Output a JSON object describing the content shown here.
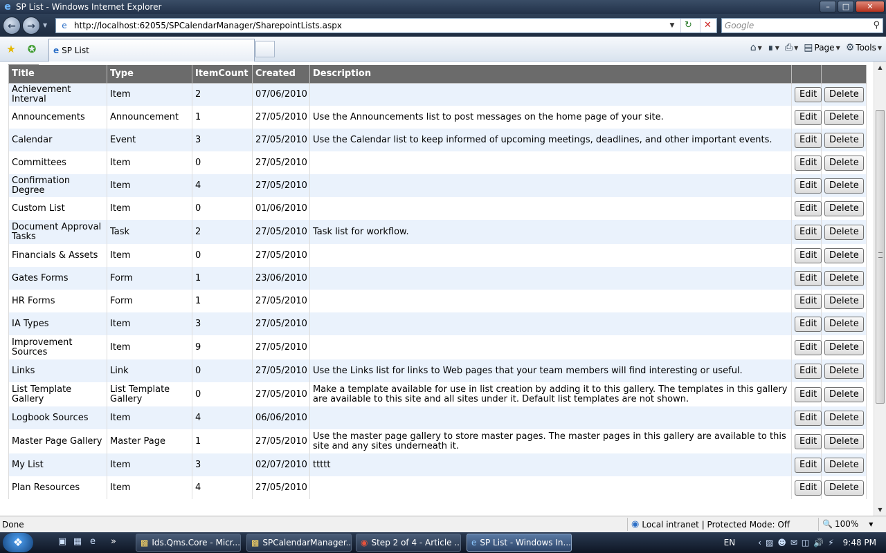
{
  "window": {
    "title": "SP List - Windows Internet Explorer"
  },
  "browser": {
    "url": "http://localhost:62055/SPCalendarManager/SharepointLists.aspx",
    "search_placeholder": "Google",
    "tab_title": "SP List",
    "commands": {
      "page": "Page",
      "tools": "Tools"
    }
  },
  "table": {
    "headers": [
      "Title",
      "Type",
      "ItemCount",
      "Created",
      "Description"
    ],
    "edit_label": "Edit",
    "delete_label": "Delete",
    "rows": [
      {
        "title": "Achievement Interval",
        "type": "Item",
        "count": "2",
        "created": "07/06/2010",
        "description": ""
      },
      {
        "title": "Announcements",
        "type": "Announcement",
        "count": "1",
        "created": "27/05/2010",
        "description": "Use the Announcements list to post messages on the home page of your site."
      },
      {
        "title": "Calendar",
        "type": "Event",
        "count": "3",
        "created": "27/05/2010",
        "description": "Use the Calendar list to keep informed of upcoming meetings, deadlines, and other important events."
      },
      {
        "title": "Committees",
        "type": "Item",
        "count": "0",
        "created": "27/05/2010",
        "description": ""
      },
      {
        "title": "Confirmation Degree",
        "type": "Item",
        "count": "4",
        "created": "27/05/2010",
        "description": ""
      },
      {
        "title": "Custom List",
        "type": "Item",
        "count": "0",
        "created": "01/06/2010",
        "description": ""
      },
      {
        "title": "Document Approval Tasks",
        "type": "Task",
        "count": "2",
        "created": "27/05/2010",
        "description": "Task list for workflow."
      },
      {
        "title": "Financials & Assets",
        "type": "Item",
        "count": "0",
        "created": "27/05/2010",
        "description": ""
      },
      {
        "title": "Gates Forms",
        "type": "Form",
        "count": "1",
        "created": "23/06/2010",
        "description": ""
      },
      {
        "title": "HR Forms",
        "type": "Form",
        "count": "1",
        "created": "27/05/2010",
        "description": ""
      },
      {
        "title": "IA Types",
        "type": "Item",
        "count": "3",
        "created": "27/05/2010",
        "description": ""
      },
      {
        "title": "Improvement Sources",
        "type": "Item",
        "count": "9",
        "created": "27/05/2010",
        "description": ""
      },
      {
        "title": "Links",
        "type": "Link",
        "count": "0",
        "created": "27/05/2010",
        "description": "Use the Links list for links to Web pages that your team members will find interesting or useful."
      },
      {
        "title": "List Template Gallery",
        "type": "List Template Gallery",
        "count": "0",
        "created": "27/05/2010",
        "description": "Make a template available for use in list creation by adding it to this gallery. The templates in this gallery are available to this site and all sites under it. Default list templates are not shown."
      },
      {
        "title": "Logbook Sources",
        "type": "Item",
        "count": "4",
        "created": "06/06/2010",
        "description": ""
      },
      {
        "title": "Master Page Gallery",
        "type": "Master Page",
        "count": "1",
        "created": "27/05/2010",
        "description": "Use the master page gallery to store master pages. The master pages in this gallery are available to this site and any sites underneath it."
      },
      {
        "title": "My List",
        "type": "Item",
        "count": "3",
        "created": "02/07/2010",
        "description": "ttttt"
      },
      {
        "title": "Plan Resources",
        "type": "Item",
        "count": "4",
        "created": "27/05/2010",
        "description": ""
      }
    ]
  },
  "status": {
    "text": "Done",
    "zone": "Local intranet | Protected Mode: Off",
    "zoom": "100%"
  },
  "taskbar": {
    "tasks": [
      "Ids.Qms.Core - Micr...",
      "SPCalendarManager...",
      "Step 2 of 4 - Article ...",
      "SP List - Windows In..."
    ],
    "lang": "EN",
    "time": "9:48 PM"
  }
}
